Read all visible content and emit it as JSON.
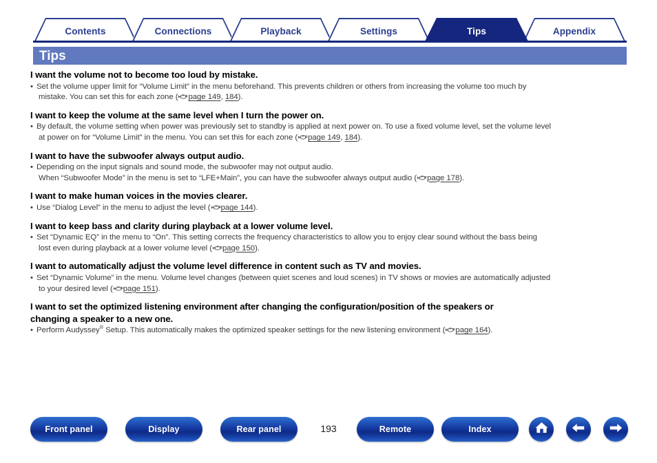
{
  "tabs": [
    {
      "label": "Contents",
      "active": false
    },
    {
      "label": "Connections",
      "active": false
    },
    {
      "label": "Playback",
      "active": false
    },
    {
      "label": "Settings",
      "active": false
    },
    {
      "label": "Tips",
      "active": true
    },
    {
      "label": "Appendix",
      "active": false
    }
  ],
  "page": {
    "title": "Tips",
    "number": "193"
  },
  "colors": {
    "tab_text": "#2a3d8f",
    "tab_active_bg": "#14267e",
    "title_bar_bg": "#6079bf",
    "button_blue": "#14379e",
    "body_text": "#3a3a3a"
  },
  "sections": [
    {
      "heading": "I want the volume not to become too loud by mistake.",
      "line1": "Set the volume upper limit for “Volume Limit” in the menu beforehand. This prevents children or others from increasing the volume too much by",
      "line2_pre": "mistake. You can set this for each zone (",
      "links": [
        "page 149",
        "184"
      ],
      "link_sep": ", ",
      "line2_post": ")."
    },
    {
      "heading": "I want to keep the volume at the same level when I turn the power on.",
      "line1": "By default, the volume setting when power was previously set to standby is applied at next power on. To use a fixed volume level, set the volume level",
      "line2_pre": "at power on for “Volume Limit” in the menu. You can set this for each zone (",
      "links": [
        "page 149",
        "184"
      ],
      "link_sep": ", ",
      "line2_post": ")."
    },
    {
      "heading": "I want to have the subwoofer always output audio.",
      "line1": "Depending on the input signals and sound mode, the subwoofer may not output audio.",
      "line2_pre": "When “Subwoofer Mode” in the menu is set to “LFE+Main”, you can have the subwoofer always output audio (",
      "links": [
        "page 178"
      ],
      "link_sep": "",
      "line2_post": ")."
    },
    {
      "heading": "I want to make human voices in the movies clearer.",
      "line1_pre": "Use “Dialog Level” in the menu to adjust the level (",
      "links": [
        "page 144"
      ],
      "link_sep": "",
      "line1_post": ")."
    },
    {
      "heading": "I want to keep bass and clarity during playback at a lower volume level.",
      "line1": "Set “Dynamic EQ” in the menu to “On”. This setting corrects the frequency characteristics to allow you to enjoy clear sound without the bass being",
      "line2_pre": "lost even during playback at a lower volume level (",
      "links": [
        "page 150"
      ],
      "link_sep": "",
      "line2_post": ")."
    },
    {
      "heading": "I want to automatically adjust the volume level difference in content such as TV and movies.",
      "line1": "Set “Dynamic Volume” in the menu. Volume level changes (between quiet scenes and loud scenes) in TV shows or movies are automatically adjusted",
      "line2_pre": "to your desired level (",
      "links": [
        "page 151"
      ],
      "link_sep": "",
      "line2_post": ")."
    },
    {
      "heading_line1": "I want to set the optimized listening environment after changing the configuration/position of the speakers or",
      "heading_line2": "changing a speaker to a new one.",
      "line1_pre_a": "Perform Audyssey",
      "superscript": "®",
      "line1_pre_b": " Setup. This automatically makes the optimized speaker settings for the new listening environment (",
      "links": [
        "page 164"
      ],
      "link_sep": "",
      "line1_post": ")."
    }
  ],
  "footer": {
    "buttons": [
      {
        "label": "Front panel",
        "name": "front-panel-button"
      },
      {
        "label": "Display",
        "name": "display-button"
      },
      {
        "label": "Rear panel",
        "name": "rear-panel-button"
      },
      {
        "label": "Remote",
        "name": "remote-button"
      },
      {
        "label": "Index",
        "name": "index-button"
      }
    ],
    "icons": [
      {
        "name": "home-icon"
      },
      {
        "name": "arrow-left-icon"
      },
      {
        "name": "arrow-right-icon"
      }
    ]
  }
}
